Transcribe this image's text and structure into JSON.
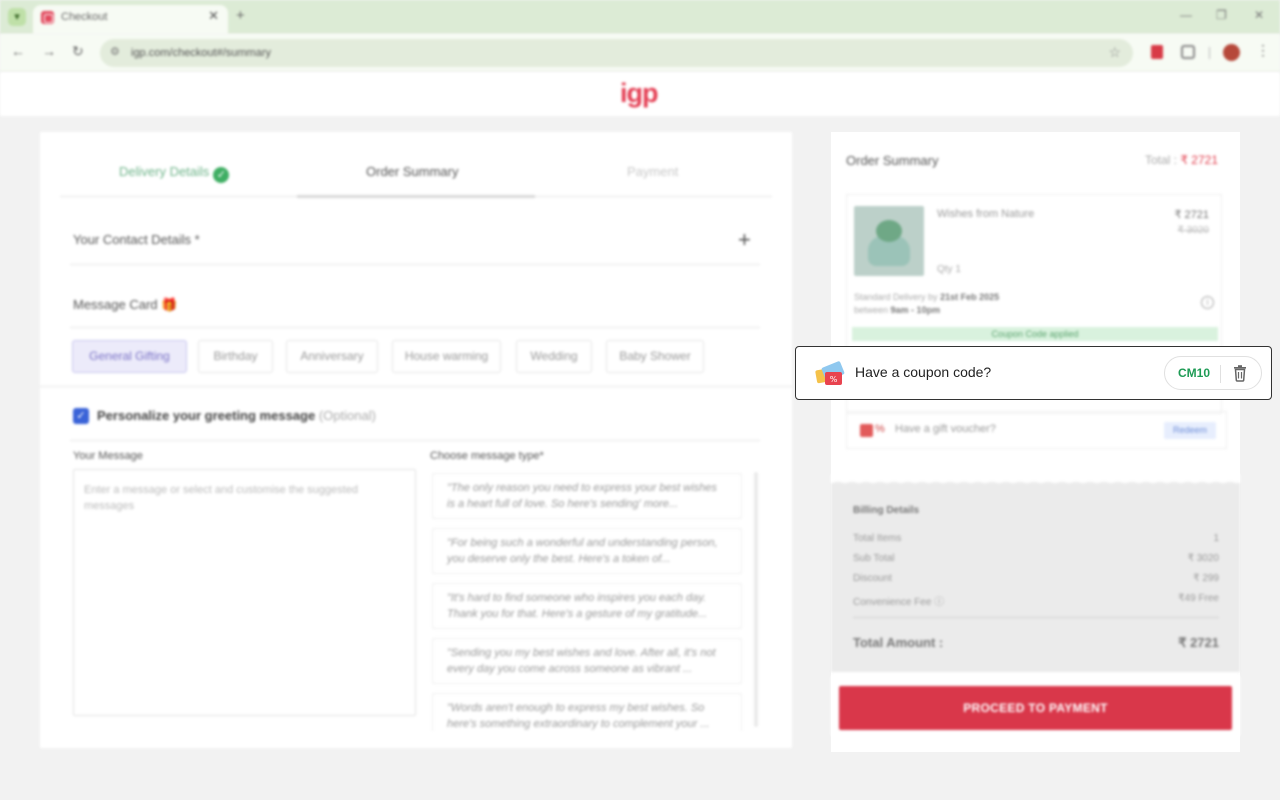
{
  "browser": {
    "tab_title": "Checkout",
    "url": "igp.com/checkout#/summary"
  },
  "site": {
    "logo": "igp"
  },
  "steps": [
    {
      "label": "Delivery Details"
    },
    {
      "label": "Order Summary"
    },
    {
      "label": "Payment"
    }
  ],
  "contact": {
    "title": "Your Contact Details *"
  },
  "message_card": {
    "title": "Message Card 🎁",
    "occasions": [
      "General Gifting",
      "Birthday",
      "Anniversary",
      "House warming",
      "Wedding",
      "Baby Shower"
    ],
    "personalize_label": "Personalize your greeting message",
    "personalize_optional": "(Optional)",
    "your_message_label": "Your Message",
    "message_placeholder": "Enter a message or select and customise the suggested messages",
    "choose_type_label": "Choose message type*",
    "suggestions": [
      "\"The only reason you need to express your best wishes is a heart full of love. So here's sending' more...",
      "\"For being such a wonderful and understanding person, you deserve only the best. Here's a token of...",
      "\"It's hard to find someone who inspires you each day. Thank you for that. Here's a gesture of my gratitude...",
      "\"Sending you my best wishes and love. After all, it's not every day you come across someone as vibrant ...",
      "\"Words aren't enough to express my best wishes. So here's something extraordinary to complement your ..."
    ]
  },
  "order_summary": {
    "title": "Order Summary",
    "total_label": "Total :",
    "total_value": "₹ 2721",
    "product": {
      "name": "Wishes from Nature",
      "price": "₹ 2721",
      "mrp": "₹ 3020",
      "qty": "Qty 1",
      "delivery_prefix": "Standard Delivery by",
      "delivery_date": "21st Feb 2025",
      "delivery_time_prefix": "between",
      "delivery_time": "9am - 10pm"
    },
    "coupon_applied": "Coupon Code applied",
    "coupon": {
      "prompt": "Have a coupon code?",
      "code": "CM10"
    },
    "gift_voucher": {
      "prompt": "Have a gift voucher?",
      "action": "Redeem"
    }
  },
  "billing": {
    "title": "Billing Details",
    "rows": [
      {
        "label": "Total Items",
        "value": "1"
      },
      {
        "label": "Sub Total",
        "value": "₹ 3020"
      },
      {
        "label": "Discount",
        "value": "₹ 299"
      },
      {
        "label": "Convenience Fee ⓘ",
        "value": "₹49 Free"
      }
    ],
    "total_label": "Total Amount :",
    "total_value": "₹ 2721"
  },
  "cta": {
    "proceed": "PROCEED TO PAYMENT"
  },
  "colors": {
    "brand": "#e43f54",
    "cta": "#d9374a",
    "coupon_code": "#1e9b55"
  }
}
